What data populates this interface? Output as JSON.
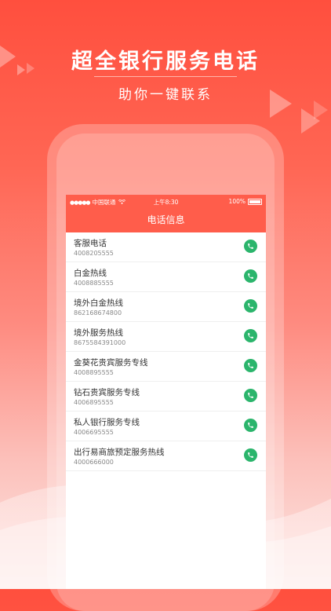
{
  "hero": {
    "title": "超全银行服务电话",
    "subtitle": "助你一键联系"
  },
  "status_bar": {
    "signal": "●●●●●",
    "carrier": "中国联通",
    "time": "上午8:30",
    "battery": "100%"
  },
  "nav": {
    "title": "电话信息"
  },
  "contacts": [
    {
      "name": "客服电话",
      "number": "4008205555"
    },
    {
      "name": "白金热线",
      "number": "4008885555"
    },
    {
      "name": "境外白金热线",
      "number": "862168674800"
    },
    {
      "name": "境外服务热线",
      "number": "8675584391000"
    },
    {
      "name": "金葵花贵宾服务专线",
      "number": "4008895555"
    },
    {
      "name": "钻石贵宾服务专线",
      "number": "4006895555"
    },
    {
      "name": "私人银行服务专线",
      "number": "4006695555"
    },
    {
      "name": "出行易商旅预定服务热线",
      "number": "4000666000"
    }
  ],
  "colors": {
    "brand_red": "#ff5d4b",
    "call_green": "#2bb56c"
  },
  "icons": [
    "phone-icon",
    "wifi-icon",
    "battery-icon"
  ]
}
